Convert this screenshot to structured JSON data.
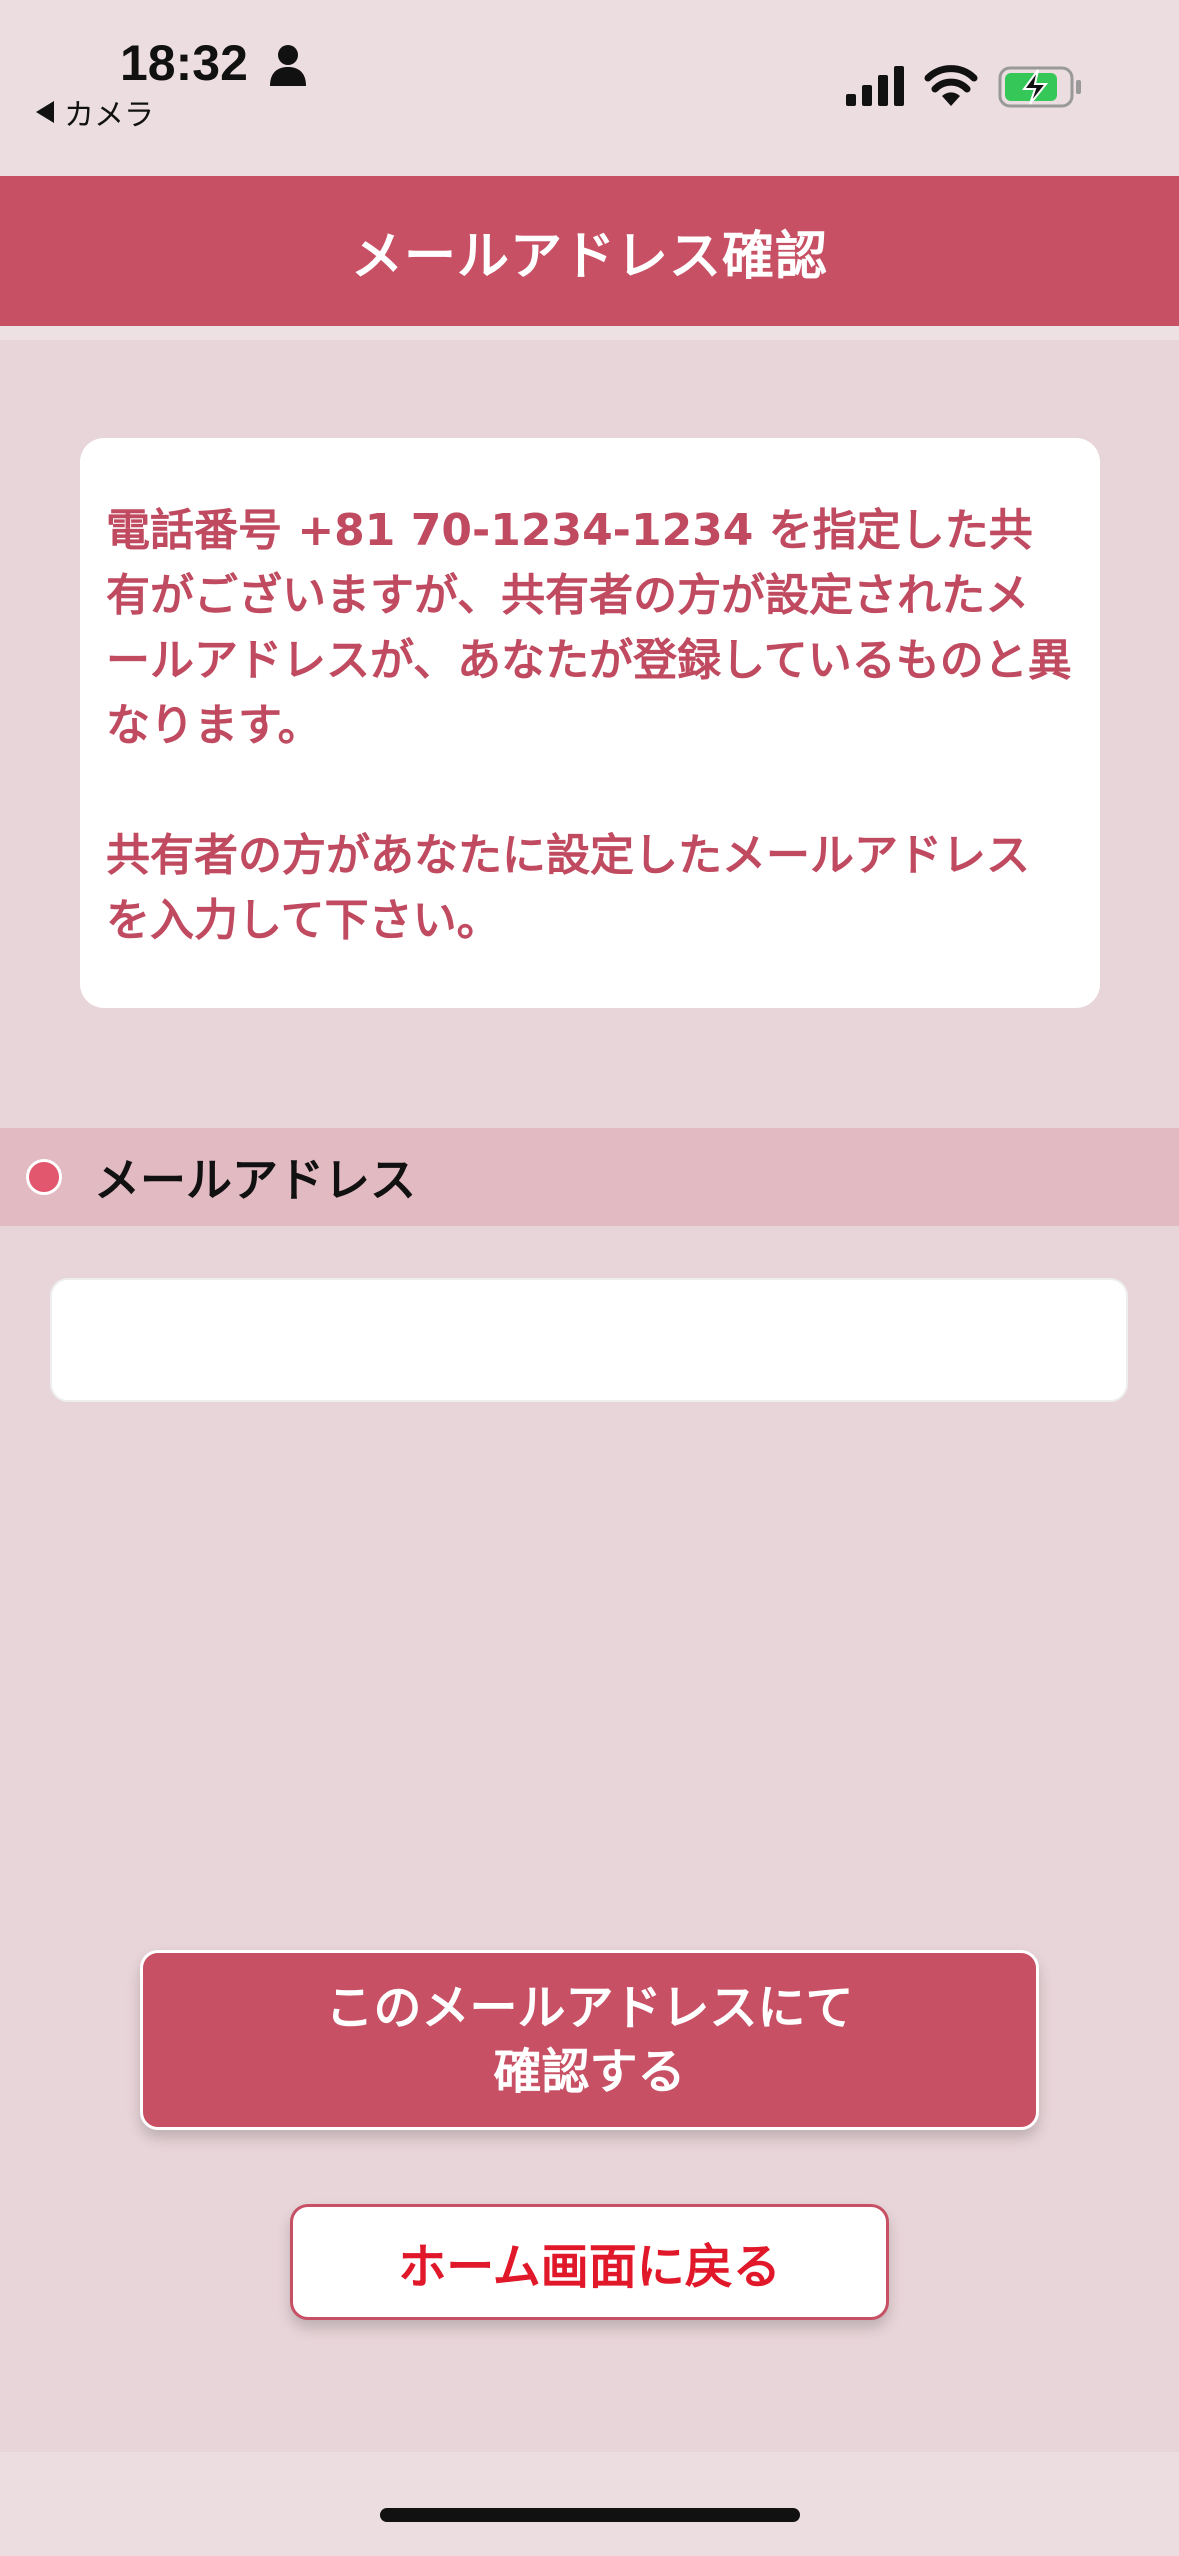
{
  "status_bar": {
    "time": "18:32",
    "back_app": "カメラ",
    "icons": [
      "person-icon",
      "signal-icon",
      "wifi-icon",
      "battery-charging-icon"
    ]
  },
  "header": {
    "title": "メールアドレス確認",
    "color": "#c85064"
  },
  "message": {
    "paragraph1": "電話番号 +81 70-1234-1234 を指定した共有がございますが、共有者の方が設定されたメールアドレスが、あなたが登録しているものと異なります。",
    "paragraph2": "共有者の方があなたに設定したメールアドレスを入力して下さい。",
    "text_color": "#c04a60"
  },
  "email_section": {
    "label": "メールアドレス",
    "value": "",
    "placeholder": ""
  },
  "buttons": {
    "confirm_line1": "このメールアドレスにて",
    "confirm_line2": "確認する",
    "home": "ホーム画面に戻る"
  }
}
